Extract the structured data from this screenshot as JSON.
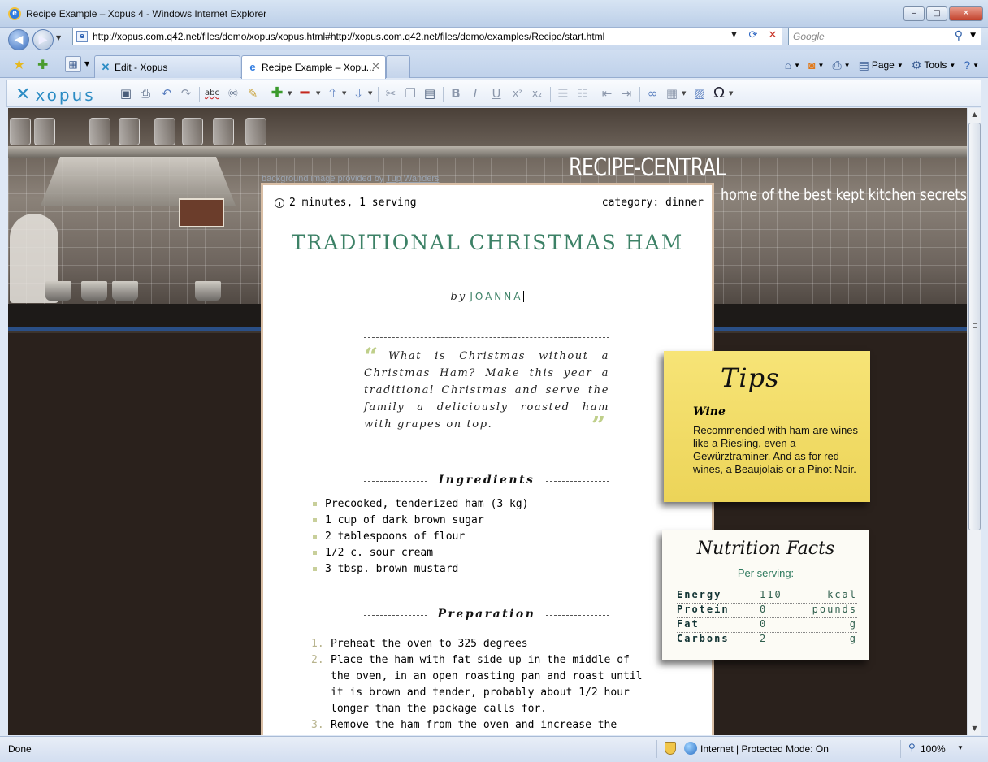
{
  "window": {
    "title": "Recipe Example – Xopus 4 - Windows Internet Explorer",
    "controls": {
      "minimize": "–",
      "maximize": "□",
      "close": "✕"
    }
  },
  "navigation": {
    "url": "http://xopus.com.q42.net/files/demo/xopus/xopus.html#http://xopus.com.q42.net/files/demo/examples/Recipe/start.html",
    "search_placeholder": "Google"
  },
  "tabs": [
    {
      "label": "Edit - Xopus",
      "active": false
    },
    {
      "label": "Recipe Example – Xopu...",
      "active": true
    }
  ],
  "commandbar": {
    "page": "Page",
    "tools": "Tools"
  },
  "editor": {
    "brand": "xopus"
  },
  "site": {
    "title": "RECIPE-CENTRAL",
    "tagline": "home of the best kept kitchen secrets",
    "credit_prefix": "background image provided by ",
    "credit_author": "Tup Wanders"
  },
  "recipe": {
    "time_servings": "2 minutes, 1 serving",
    "category": "category: dinner",
    "title": "TRADITIONAL CHRISTMAS HAM",
    "by": "by",
    "author": "JOANNA",
    "intro": "What is Christmas without a Christmas Ham? Make this year a traditional Christmas and serve the family a deliciously roasted ham with grapes on top.",
    "ingredients_heading": "Ingredients",
    "ingredients": [
      "Precooked, tenderized ham (3 kg)",
      "1 cup of dark brown sugar",
      "2 tablespoons of flour",
      "1/2 c. sour cream",
      "3 tbsp. brown mustard"
    ],
    "preparation_heading": "Preparation",
    "steps": [
      {
        "num": "1.",
        "text": "Preheat the oven to 325 degrees"
      },
      {
        "num": "2.",
        "text": "Place the ham with fat side up in the middle of the oven, in an open roasting pan and roast until it is brown and tender, probably about 1/2 hour longer than the package calls for."
      },
      {
        "num": "3.",
        "text": "Remove the ham from the oven and increase the"
      }
    ]
  },
  "tips": {
    "title": "Tips",
    "heading": "Wine",
    "text": "Recommended with ham are wines like a Riesling, even a Gewürztraminer. And as for red wines, a Beaujolais or a Pinot Noir."
  },
  "nutrition": {
    "title": "Nutrition Facts",
    "subtitle": "Per serving:",
    "rows": [
      {
        "name": "Energy",
        "value": "110",
        "unit": "kcal"
      },
      {
        "name": "Protein",
        "value": "0",
        "unit": "pounds"
      },
      {
        "name": "Fat",
        "value": "0",
        "unit": "g"
      },
      {
        "name": "Carbons",
        "value": "2",
        "unit": "g"
      }
    ]
  },
  "status": {
    "text": "Done",
    "zone": "Internet | Protected Mode: On",
    "zoom": "100%"
  },
  "colors": {
    "accent_green": "#3c8166",
    "note_yellow": "#f2dc68",
    "background_dark": "#2a211c"
  }
}
